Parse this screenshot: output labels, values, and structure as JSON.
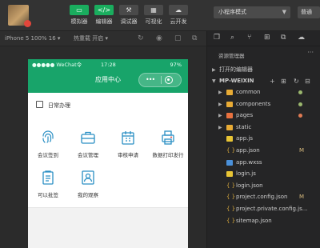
{
  "toolbar": {
    "tools": [
      {
        "label": "模拟器",
        "glyph": "▭",
        "active": true
      },
      {
        "label": "编辑器",
        "glyph": "</>",
        "active": true
      },
      {
        "label": "调试器",
        "glyph": "⚒",
        "active": false
      },
      {
        "label": "可视化",
        "glyph": "▦",
        "active": false
      },
      {
        "label": "云开发",
        "glyph": "☁",
        "active": false
      }
    ],
    "mode_value": "小程序模式",
    "compile_label": "普通"
  },
  "simulator": {
    "device": "iPhone 5 100% 16 ▾",
    "zoom": "热重载 开启 ▾"
  },
  "phone": {
    "signal": "●●●●● WeChat令",
    "time": "17:28",
    "battery": "97%",
    "nav_title": "应用中心",
    "capsule_dots": "•••",
    "section_title": "日常办理",
    "apps": [
      {
        "label": "会议签到",
        "icon": "fingerprint-icon"
      },
      {
        "label": "会议管理",
        "icon": "briefcase-icon"
      },
      {
        "label": "审核申请",
        "icon": "calendar-icon"
      },
      {
        "label": "数据打印发行",
        "icon": "printer-icon"
      },
      {
        "label": "可以批签",
        "icon": "document-icon"
      },
      {
        "label": "我的观察",
        "icon": "contact-icon"
      }
    ]
  },
  "explorer": {
    "tab_icons": [
      "files-icon",
      "search-icon",
      "source-control-icon",
      "extensions-icon",
      "copy-icon",
      "cloud-icon"
    ],
    "title": "资源管理器",
    "more": "···",
    "open_editors": "打开的编辑器",
    "project": "MP-WEIXIN",
    "files": [
      {
        "name": "common",
        "type": "folder",
        "color": "#e8ab35",
        "badge": "",
        "status": "dot",
        "status_color": "#9bb86e"
      },
      {
        "name": "components",
        "type": "folder",
        "color": "#e8ab35",
        "badge": "",
        "status": "dot",
        "status_color": "#9bb86e"
      },
      {
        "name": "pages",
        "type": "folder",
        "color": "#e8713f",
        "badge": "",
        "status": "dot",
        "status_color": "#e07b53"
      },
      {
        "name": "static",
        "type": "folder",
        "color": "#e8ab35",
        "badge": "",
        "status": "",
        "status_color": ""
      },
      {
        "name": "app.js",
        "type": "js",
        "color": "#e8c535",
        "badge": "",
        "status": "",
        "status_color": ""
      },
      {
        "name": "app.json",
        "type": "json",
        "color": "#d9a93c",
        "badge": "M",
        "status": "",
        "status_color": ""
      },
      {
        "name": "app.wxss",
        "type": "wxss",
        "color": "#4a90d9",
        "badge": "",
        "status": "",
        "status_color": ""
      },
      {
        "name": "login.js",
        "type": "js",
        "color": "#e8c535",
        "badge": "",
        "status": "",
        "status_color": ""
      },
      {
        "name": "login.json",
        "type": "json",
        "color": "#d9a93c",
        "badge": "",
        "status": "",
        "status_color": ""
      },
      {
        "name": "project.config.json",
        "type": "json",
        "color": "#d9a93c",
        "badge": "M",
        "status": "",
        "status_color": ""
      },
      {
        "name": "project.private.config.js...",
        "type": "json",
        "color": "#d9a93c",
        "badge": "",
        "status": "",
        "status_color": ""
      },
      {
        "name": "sitemap.json",
        "type": "json",
        "color": "#d9a93c",
        "badge": "",
        "status": "",
        "status_color": ""
      }
    ]
  }
}
